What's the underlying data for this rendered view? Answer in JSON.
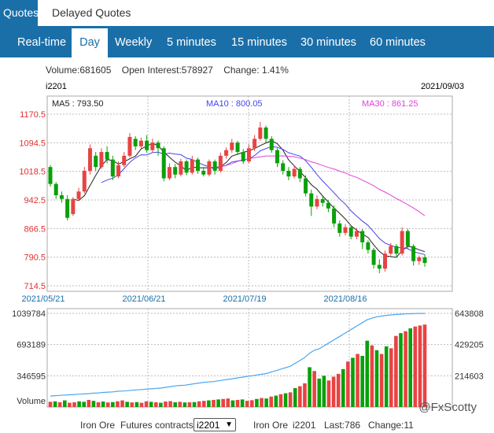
{
  "top_tabs": [
    {
      "label": "Quotes",
      "active": true
    },
    {
      "label": "Delayed Quotes",
      "active": false
    }
  ],
  "period_tabs": [
    {
      "label": "Real-time"
    },
    {
      "label": "Day",
      "active": true
    },
    {
      "label": "Weekly"
    },
    {
      "label": "5 minutes"
    },
    {
      "label": "15 minutes"
    },
    {
      "label": "30 minutes"
    },
    {
      "label": "60 minutes"
    }
  ],
  "stats": {
    "volume": "Volume:681605",
    "open_interest": "Open Interest:578927",
    "change": "Change: 1.41%"
  },
  "contract_code": "i2201",
  "chart_date": "2021/09/03",
  "colors": {
    "up": "#e84343",
    "down": "#0aa00a",
    "ma5": "#222222",
    "ma10": "#4444ee",
    "ma30": "#dd44dd",
    "oi_line": "#4da6ee",
    "accent": "#1b6fa8"
  },
  "chart_data": [
    {
      "type": "candlestick",
      "title": "",
      "ma_labels": [
        {
          "name": "MA5",
          "text": "MA5 : 793.50"
        },
        {
          "name": "MA10",
          "text": "MA10 : 800.05"
        },
        {
          "name": "MA30",
          "text": "MA30 : 861.25"
        }
      ],
      "y_ticks": [
        "1170.5",
        "1094.5",
        "1018.5",
        "942.5",
        "866.5",
        "790.5",
        "714.5"
      ],
      "ylim": [
        714.5,
        1170.5
      ],
      "x_ticks": [
        "2021/05/21",
        "2021/06/21",
        "2021/07/19",
        "2021/08/16"
      ],
      "grid": true,
      "candles": [
        {
          "o": 1030,
          "c": 985,
          "h": 1035,
          "l": 978
        },
        {
          "o": 985,
          "c": 955,
          "h": 990,
          "l": 945
        },
        {
          "o": 955,
          "c": 945,
          "h": 965,
          "l": 935
        },
        {
          "o": 945,
          "c": 895,
          "h": 955,
          "l": 888
        },
        {
          "o": 905,
          "c": 945,
          "h": 950,
          "l": 900
        },
        {
          "o": 945,
          "c": 965,
          "h": 975,
          "l": 940
        },
        {
          "o": 965,
          "c": 1020,
          "h": 1030,
          "l": 960
        },
        {
          "o": 1020,
          "c": 1080,
          "h": 1090,
          "l": 1010
        },
        {
          "o": 1060,
          "c": 1030,
          "h": 1070,
          "l": 1020
        },
        {
          "o": 1030,
          "c": 1070,
          "h": 1080,
          "l": 1025
        },
        {
          "o": 1070,
          "c": 1050,
          "h": 1085,
          "l": 1040
        },
        {
          "o": 1050,
          "c": 1005,
          "h": 1060,
          "l": 995
        },
        {
          "o": 1005,
          "c": 1035,
          "h": 1045,
          "l": 1000
        },
        {
          "o": 1035,
          "c": 1060,
          "h": 1070,
          "l": 1030
        },
        {
          "o": 1060,
          "c": 1110,
          "h": 1120,
          "l": 1055
        },
        {
          "o": 1105,
          "c": 1085,
          "h": 1112,
          "l": 1075
        },
        {
          "o": 1085,
          "c": 1100,
          "h": 1108,
          "l": 1080
        },
        {
          "o": 1100,
          "c": 1075,
          "h": 1115,
          "l": 1068
        },
        {
          "o": 1075,
          "c": 1095,
          "h": 1105,
          "l": 1070
        },
        {
          "o": 1095,
          "c": 1080,
          "h": 1100,
          "l": 1060
        },
        {
          "o": 1080,
          "c": 1000,
          "h": 1085,
          "l": 992
        },
        {
          "o": 1000,
          "c": 1030,
          "h": 1040,
          "l": 995
        },
        {
          "o": 1030,
          "c": 1010,
          "h": 1038,
          "l": 1000
        },
        {
          "o": 1010,
          "c": 1045,
          "h": 1052,
          "l": 1005
        },
        {
          "o": 1045,
          "c": 1015,
          "h": 1050,
          "l": 1008
        },
        {
          "o": 1015,
          "c": 1050,
          "h": 1060,
          "l": 1010
        },
        {
          "o": 1050,
          "c": 1020,
          "h": 1055,
          "l": 1012
        },
        {
          "o": 1020,
          "c": 1010,
          "h": 1030,
          "l": 1005
        },
        {
          "o": 1010,
          "c": 1045,
          "h": 1050,
          "l": 1005
        },
        {
          "o": 1045,
          "c": 1020,
          "h": 1050,
          "l": 1010
        },
        {
          "o": 1020,
          "c": 1060,
          "h": 1068,
          "l": 1015
        },
        {
          "o": 1060,
          "c": 1075,
          "h": 1082,
          "l": 1052
        },
        {
          "o": 1075,
          "c": 1095,
          "h": 1105,
          "l": 1068
        },
        {
          "o": 1095,
          "c": 1070,
          "h": 1100,
          "l": 1062
        },
        {
          "o": 1070,
          "c": 1045,
          "h": 1078,
          "l": 1038
        },
        {
          "o": 1045,
          "c": 1080,
          "h": 1090,
          "l": 1040
        },
        {
          "o": 1080,
          "c": 1105,
          "h": 1115,
          "l": 1072
        },
        {
          "o": 1105,
          "c": 1135,
          "h": 1150,
          "l": 1100
        },
        {
          "o": 1135,
          "c": 1105,
          "h": 1140,
          "l": 1095
        },
        {
          "o": 1105,
          "c": 1075,
          "h": 1112,
          "l": 1068
        },
        {
          "o": 1075,
          "c": 1040,
          "h": 1080,
          "l": 1030
        },
        {
          "o": 1040,
          "c": 1020,
          "h": 1048,
          "l": 1010
        },
        {
          "o": 1020,
          "c": 1005,
          "h": 1030,
          "l": 995
        },
        {
          "o": 1005,
          "c": 1025,
          "h": 1035,
          "l": 1000
        },
        {
          "o": 1025,
          "c": 1000,
          "h": 1030,
          "l": 990
        },
        {
          "o": 1000,
          "c": 960,
          "h": 1008,
          "l": 952
        },
        {
          "o": 960,
          "c": 925,
          "h": 970,
          "l": 900
        },
        {
          "o": 925,
          "c": 945,
          "h": 955,
          "l": 918
        },
        {
          "o": 945,
          "c": 935,
          "h": 952,
          "l": 925
        },
        {
          "o": 935,
          "c": 920,
          "h": 942,
          "l": 910
        },
        {
          "o": 920,
          "c": 880,
          "h": 928,
          "l": 870
        },
        {
          "o": 880,
          "c": 855,
          "h": 888,
          "l": 845
        },
        {
          "o": 855,
          "c": 870,
          "h": 878,
          "l": 848
        },
        {
          "o": 870,
          "c": 845,
          "h": 875,
          "l": 838
        },
        {
          "o": 845,
          "c": 860,
          "h": 868,
          "l": 838
        },
        {
          "o": 860,
          "c": 830,
          "h": 865,
          "l": 812
        },
        {
          "o": 830,
          "c": 810,
          "h": 835,
          "l": 800
        },
        {
          "o": 810,
          "c": 770,
          "h": 815,
          "l": 760
        },
        {
          "o": 770,
          "c": 760,
          "h": 785,
          "l": 748
        },
        {
          "o": 760,
          "c": 800,
          "h": 808,
          "l": 752
        },
        {
          "o": 800,
          "c": 820,
          "h": 828,
          "l": 795
        },
        {
          "o": 820,
          "c": 800,
          "h": 825,
          "l": 790
        },
        {
          "o": 800,
          "c": 860,
          "h": 870,
          "l": 795
        },
        {
          "o": 860,
          "c": 820,
          "h": 866,
          "l": 812
        },
        {
          "o": 820,
          "c": 780,
          "h": 825,
          "l": 768
        },
        {
          "o": 780,
          "c": 790,
          "h": 795,
          "l": 770
        },
        {
          "o": 790,
          "c": 775,
          "h": 798,
          "l": 765
        }
      ]
    },
    {
      "type": "bar+line",
      "title": "",
      "ylabel": "Volume",
      "left_ticks": [
        "1039784",
        "693189",
        "346595"
      ],
      "right_ticks": [
        "643808",
        "429205",
        "214603"
      ],
      "left_ylim": [
        0,
        1039784
      ],
      "right_ylim": [
        0,
        643808
      ],
      "grid": true,
      "volume": [
        55,
        60,
        50,
        70,
        45,
        50,
        60,
        55,
        75,
        65,
        50,
        58,
        48,
        52,
        60,
        70,
        55,
        48,
        52,
        45,
        60,
        55,
        50,
        45,
        58,
        62,
        50,
        55,
        48,
        50,
        52,
        60,
        65,
        70,
        75,
        80,
        85,
        90,
        70,
        75,
        80,
        65,
        72,
        85,
        95,
        90,
        110,
        120,
        135,
        145,
        155,
        200,
        220,
        250,
        420,
        380,
        300,
        330,
        280,
        320,
        350,
        400,
        480,
        520,
        560,
        540,
        700,
        650,
        600,
        560,
        640,
        620,
        750,
        780,
        800,
        830,
        850,
        860,
        870
      ],
      "volume_direction": [
        "u",
        "d",
        "u",
        "d",
        "u",
        "u",
        "d",
        "d",
        "u",
        "d",
        "u",
        "d",
        "u",
        "d",
        "u",
        "u",
        "d",
        "u",
        "d",
        "u",
        "u",
        "d",
        "u",
        "d",
        "u",
        "u",
        "d",
        "u",
        "d",
        "u",
        "d",
        "u",
        "u",
        "d",
        "u",
        "d",
        "u",
        "u",
        "d",
        "u",
        "d",
        "u",
        "u",
        "d",
        "u",
        "d",
        "u",
        "d",
        "u",
        "d",
        "u",
        "d",
        "u",
        "u",
        "d",
        "u",
        "d",
        "d",
        "u",
        "u",
        "u",
        "d",
        "u",
        "d",
        "u",
        "d",
        "d",
        "u",
        "d",
        "u",
        "d",
        "u",
        "u",
        "d",
        "u",
        "d",
        "u",
        "u",
        "u"
      ],
      "open_interest": [
        75,
        78,
        80,
        82,
        84,
        86,
        88,
        90,
        92,
        95,
        97,
        100,
        102,
        104,
        108,
        110,
        112,
        115,
        118,
        120,
        122,
        125,
        128,
        130,
        135,
        140,
        145,
        148,
        150,
        155,
        160,
        165,
        170,
        172,
        175,
        180,
        185,
        190,
        195,
        200,
        205,
        210,
        215,
        220,
        225,
        230,
        240,
        250,
        260,
        270,
        280,
        300,
        320,
        340,
        370,
        390,
        400,
        420,
        440,
        460,
        480,
        500,
        520,
        540,
        560,
        580,
        600,
        610,
        620,
        625,
        630,
        633,
        636,
        638,
        640,
        641,
        642,
        643,
        643
      ]
    }
  ],
  "watermark": "@FxScotty",
  "footer": {
    "commodity1": "Iron Ore",
    "futures_label": "Futures contracts",
    "selected_contract": "i2201",
    "commodity2": "Iron Ore",
    "code": "i2201",
    "last": "Last:786",
    "change": "Change:11"
  }
}
